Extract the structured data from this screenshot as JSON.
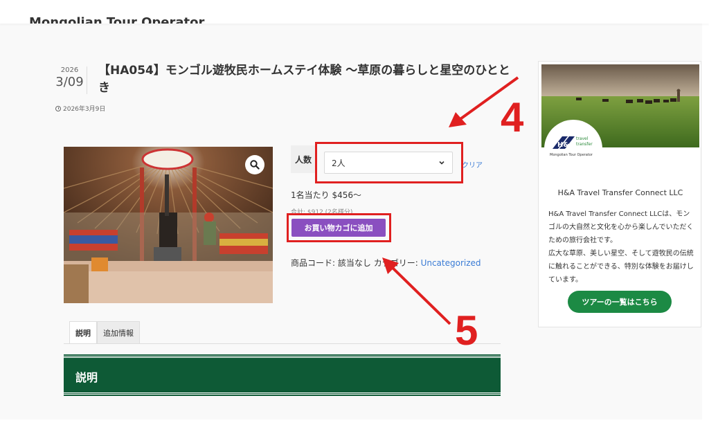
{
  "header": {
    "site_title": "Mongolian Tour Operator"
  },
  "post": {
    "date_year": "2026",
    "date_month_day": "3/09",
    "title": "【HA054】モンゴル遊牧民ホームステイ体験 〜草原の暮らしと星空のひととき",
    "published": "2026年3月9日"
  },
  "product": {
    "quantity_label": "人数",
    "quantity_selected": "2人",
    "clear_link": "クリア",
    "price_per_person": "1名当たり $456〜",
    "total": "合計: $912 (2名様分)",
    "add_to_cart": "お買い物カゴに追加",
    "sku_label": "商品コード: 該当なし",
    "category_label": "カテゴリー:",
    "category_value": "Uncategorized"
  },
  "tabs": [
    {
      "label": "説明",
      "active": true
    },
    {
      "label": "追加情報",
      "active": false
    }
  ],
  "description": {
    "heading": "説明"
  },
  "sidebar": {
    "company_name": "H&A Travel Transfer Connect LLC",
    "description": "H&A Travel Transfer Connect LLCは、モンゴルの大自然と文化を心から楽しんでいただくための旅行会社です。\n広大な草原、美しい星空、そして遊牧民の伝統に触れることができる、特別な体験をお届けしています。",
    "tour_button": "ツアーの一覧はこちら",
    "logo": {
      "mark": "H&A",
      "line1": "travel",
      "line2": "transfer",
      "caption": "Mongolian Tour Operator"
    }
  },
  "annotations": {
    "step4": "4",
    "step5": "5",
    "color": "#e02020"
  },
  "colors": {
    "accent_purple": "#8a4fc0",
    "brand_green": "#0e5a36",
    "button_green": "#1c8a44",
    "link_blue": "#3a7bd5"
  },
  "icons": {
    "zoom": "magnifier-icon",
    "clock": "clock-icon",
    "select": "chevron-down-icon"
  }
}
